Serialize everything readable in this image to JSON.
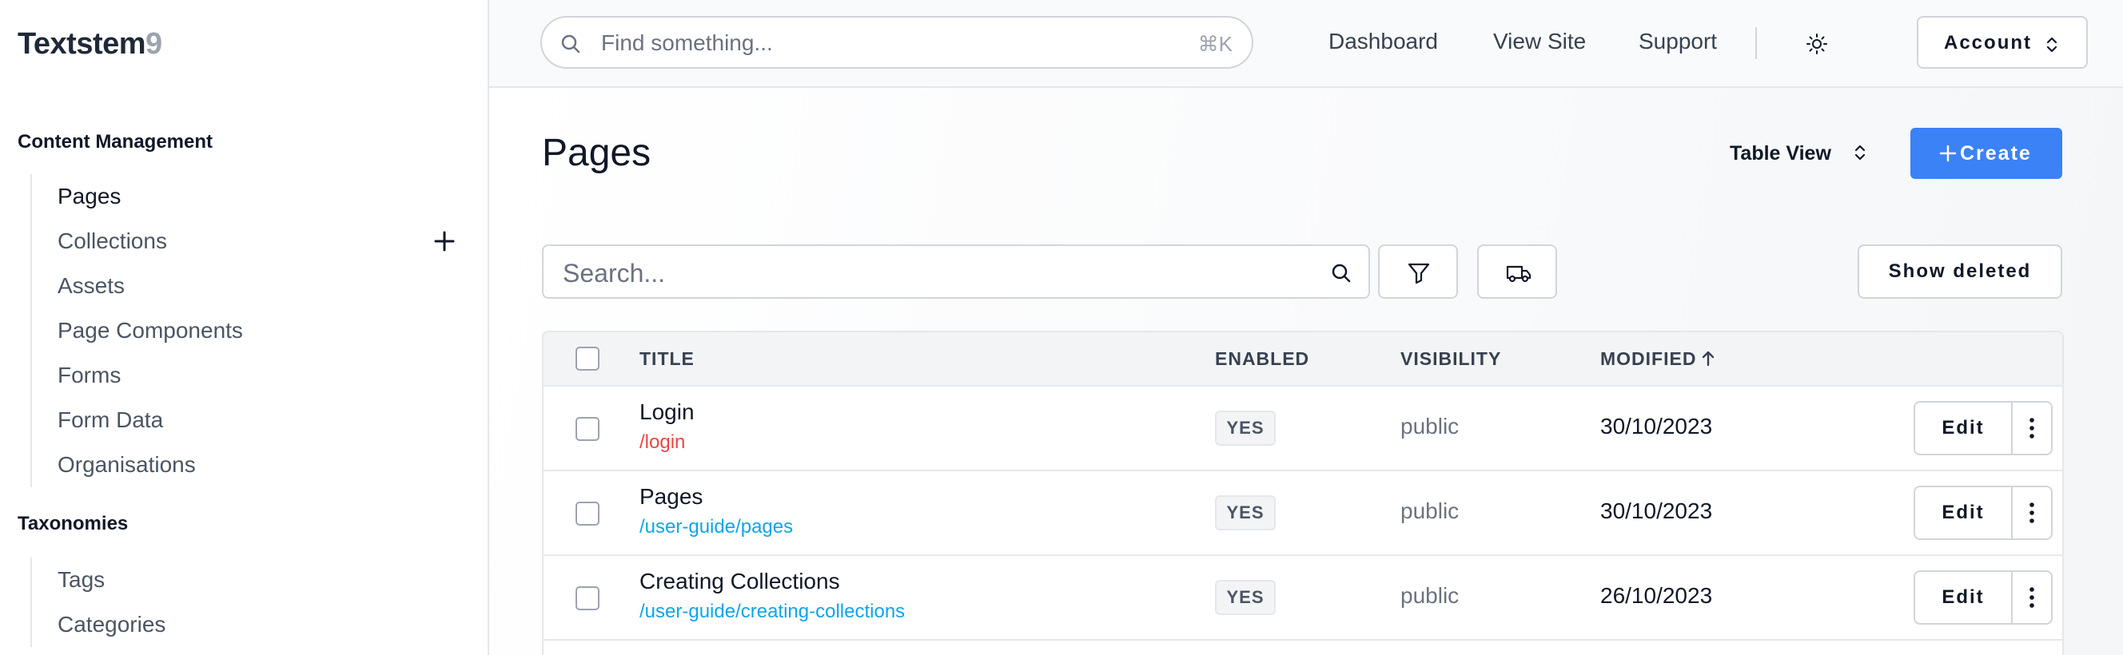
{
  "app": {
    "name": "Textstem",
    "name_suffix": "9"
  },
  "sidebar": {
    "sections": [
      {
        "title": "Content Management",
        "items": [
          {
            "label": "Pages",
            "active": true
          },
          {
            "label": "Collections",
            "has_add": true
          },
          {
            "label": "Assets"
          },
          {
            "label": "Page Components"
          },
          {
            "label": "Forms"
          },
          {
            "label": "Form Data"
          },
          {
            "label": "Organisations"
          }
        ]
      },
      {
        "title": "Taxonomies",
        "items": [
          {
            "label": "Tags"
          },
          {
            "label": "Categories"
          }
        ]
      }
    ]
  },
  "topbar": {
    "search_placeholder": "Find something...",
    "search_shortcut": "⌘K",
    "links": [
      "Dashboard",
      "View Site",
      "Support"
    ],
    "theme_icon": "sun-icon",
    "account_label": "Account"
  },
  "page": {
    "title": "Pages",
    "view_select": "Table View",
    "create_label": "Create",
    "search_placeholder": "Search...",
    "show_deleted_label": "Show deleted"
  },
  "table": {
    "columns": [
      "TITLE",
      "ENABLED",
      "VISIBILITY",
      "MODIFIED"
    ],
    "sort_column": "MODIFIED",
    "sort_direction": "ascending",
    "rows": [
      {
        "title": "Login",
        "slug": "/login",
        "slug_color": "#ef4444",
        "enabled": "YES",
        "visibility": "public",
        "modified": "30/10/2023",
        "action": "Edit"
      },
      {
        "title": "Pages",
        "slug": "/user-guide/pages",
        "slug_color": "#0ea5e9",
        "enabled": "YES",
        "visibility": "public",
        "modified": "30/10/2023",
        "action": "Edit"
      },
      {
        "title": "Creating Collections",
        "slug": "/user-guide/creating-collections",
        "slug_color": "#0ea5e9",
        "enabled": "YES",
        "visibility": "public",
        "modified": "26/10/2023",
        "action": "Edit"
      }
    ]
  },
  "colors": {
    "accent": "#3b82f6",
    "link": "#0ea5e9",
    "link_alt": "#ef4444"
  }
}
